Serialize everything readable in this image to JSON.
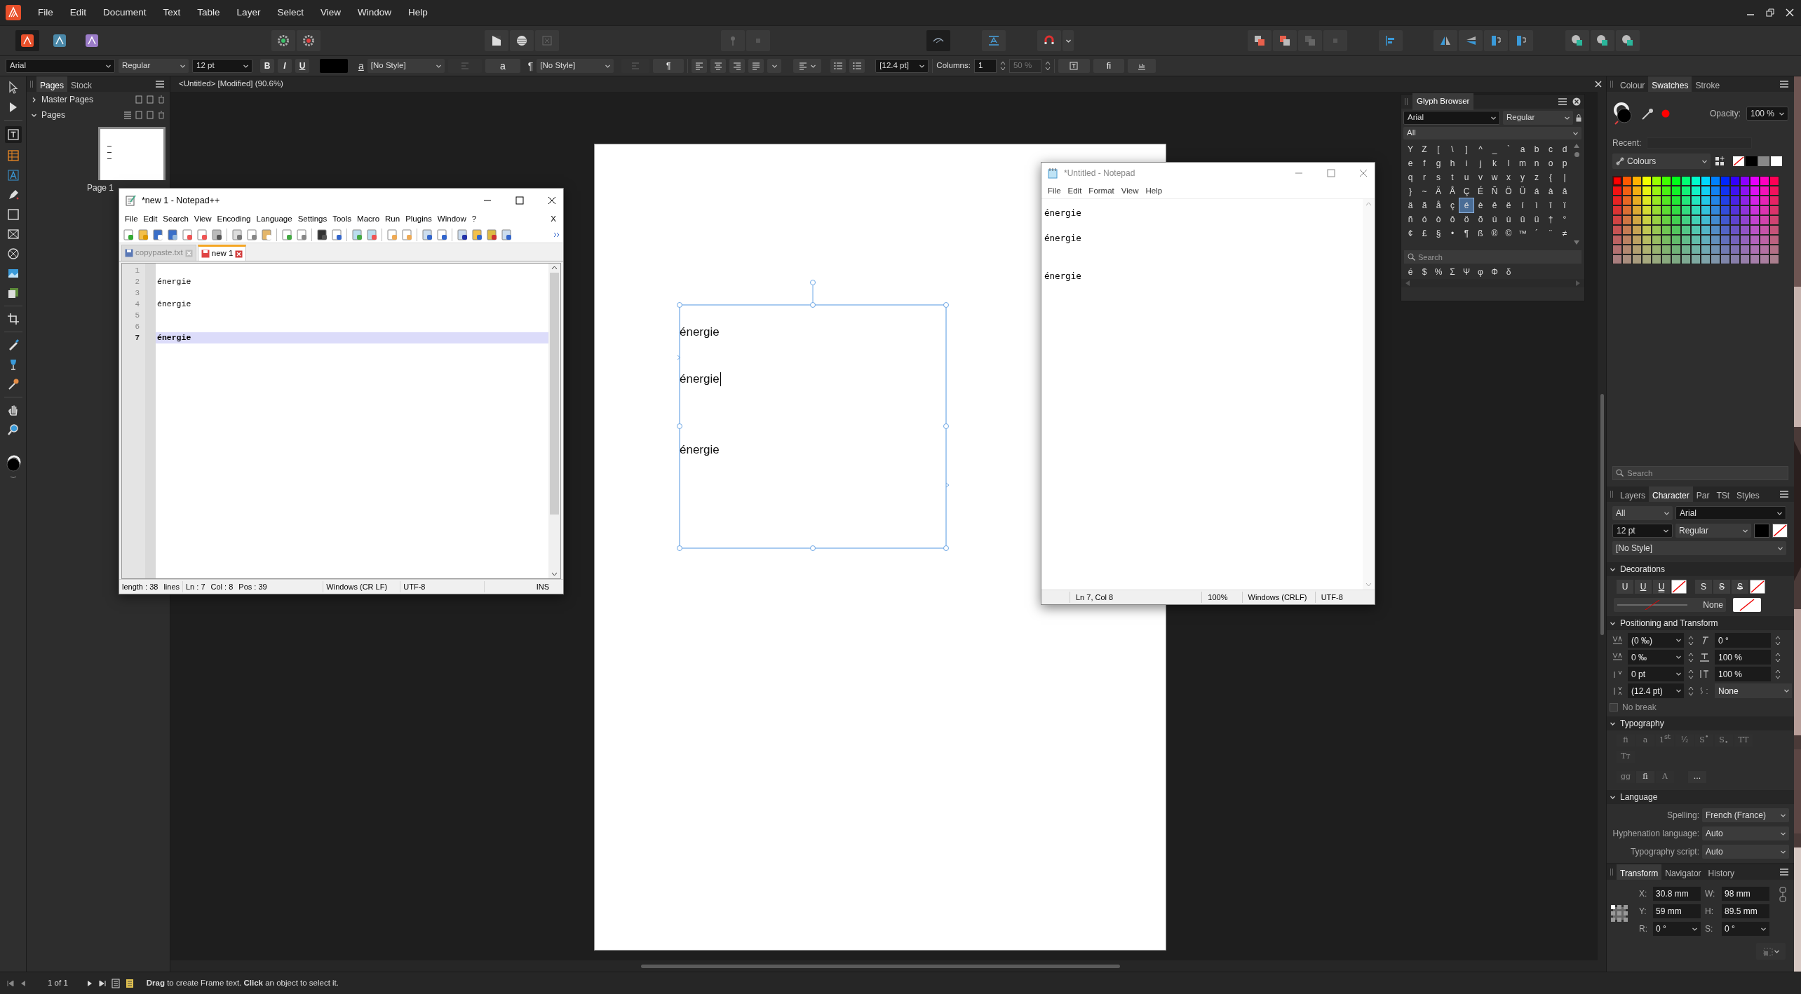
{
  "menu": [
    "File",
    "Edit",
    "Document",
    "Text",
    "Table",
    "Layer",
    "Select",
    "View",
    "Window",
    "Help"
  ],
  "context_bar": {
    "font": "Arial",
    "font_style": "Regular",
    "size": "12 pt",
    "bold": "B",
    "italic": "I",
    "underline": "U",
    "char_style_glyph": "a",
    "char_style": "[No Style]",
    "char_style_button": "a",
    "para_style_glyph": "¶",
    "para_style": "[No Style]",
    "para_style_button": "¶",
    "leading": "[12.4 pt]",
    "columns_label": "Columns:",
    "columns": "1",
    "gutter": "50 %",
    "ligature_button": "fi"
  },
  "document_tab": "<Untitled> [Modified] (90.6%)",
  "pages_panel": {
    "tabs": [
      {
        "label": "Pages",
        "selected": true
      },
      {
        "label": "Stock",
        "selected": false
      }
    ],
    "sections": [
      {
        "label": "Master Pages",
        "expanded": false
      },
      {
        "label": "Pages",
        "expanded": true
      }
    ],
    "page_label": "Page 1"
  },
  "text_frame": {
    "lines": [
      {
        "kind": "text",
        "text": "énergie",
        "caret": false
      },
      {
        "kind": "blank"
      },
      {
        "kind": "text",
        "text": "énergie",
        "caret": true
      },
      {
        "kind": "blank"
      },
      {
        "kind": "blank"
      },
      {
        "kind": "text",
        "text": "énergie",
        "caret": false
      }
    ]
  },
  "notepad_plus": {
    "title": "*new 1 - Notepad++",
    "menu": [
      "File",
      "Edit",
      "Search",
      "View",
      "Encoding",
      "Language",
      "Settings",
      "Tools",
      "Macro",
      "Run",
      "Plugins",
      "Window",
      "?"
    ],
    "close_doc": "X",
    "tabs": [
      {
        "label": "copypaste.txt",
        "selected": false
      },
      {
        "label": "new 1",
        "selected": true
      }
    ],
    "lines": [
      {
        "number": "1",
        "current": false
      },
      {
        "number": "2",
        "text": "énergie",
        "current": false
      },
      {
        "number": "3",
        "current": false
      },
      {
        "number": "4",
        "text": "énergie",
        "current": false
      },
      {
        "number": "5",
        "current": false
      },
      {
        "number": "6",
        "current": false
      },
      {
        "number": "7",
        "text": "énergie",
        "current": true
      }
    ],
    "status": {
      "length": "length : 38",
      "lines": "lines",
      "line": "Ln : 7",
      "column": "Col : 8",
      "position": "Pos : 39",
      "eol": "Windows (CR LF)",
      "encoding": "UTF-8",
      "mode": "INS"
    }
  },
  "notepad": {
    "title": "*Untitled - Notepad",
    "menu": [
      "File",
      "Edit",
      "Format",
      "View",
      "Help"
    ],
    "text": "énergie\n\nénergie\n\n\nénergie",
    "status": [
      "Ln 7, Col 8",
      "100%",
      "Windows (CRLF)",
      "UTF-8"
    ]
  },
  "glyph_browser": {
    "title": "Glyph Browser",
    "font": "Arial",
    "style": "Regular",
    "range": "All",
    "rows": [
      {
        "glyphs": [
          {
            "char": "Y",
            "selected": false
          },
          {
            "char": "Z",
            "selected": false
          },
          {
            "char": "[",
            "selected": false
          },
          {
            "char": "\\",
            "selected": false
          },
          {
            "char": "]",
            "selected": false
          },
          {
            "char": "^",
            "selected": false
          },
          {
            "char": "_",
            "selected": false
          },
          {
            "char": "`",
            "selected": false
          },
          {
            "char": "a",
            "selected": false
          },
          {
            "char": "b",
            "selected": false
          },
          {
            "char": "c",
            "selected": false
          },
          {
            "char": "d",
            "selected": false
          }
        ]
      },
      {
        "glyphs": [
          {
            "char": "e",
            "selected": false
          },
          {
            "char": "f",
            "selected": false
          },
          {
            "char": "g",
            "selected": false
          },
          {
            "char": "h",
            "selected": false
          },
          {
            "char": "i",
            "selected": false
          },
          {
            "char": "j",
            "selected": false
          },
          {
            "char": "k",
            "selected": false
          },
          {
            "char": "l",
            "selected": false
          },
          {
            "char": "m",
            "selected": false
          },
          {
            "char": "n",
            "selected": false
          },
          {
            "char": "o",
            "selected": false
          },
          {
            "char": "p",
            "selected": false
          }
        ]
      },
      {
        "glyphs": [
          {
            "char": "q",
            "selected": false
          },
          {
            "char": "r",
            "selected": false
          },
          {
            "char": "s",
            "selected": false
          },
          {
            "char": "t",
            "selected": false
          },
          {
            "char": "u",
            "selected": false
          },
          {
            "char": "v",
            "selected": false
          },
          {
            "char": "w",
            "selected": false
          },
          {
            "char": "x",
            "selected": false
          },
          {
            "char": "y",
            "selected": false
          },
          {
            "char": "z",
            "selected": false
          },
          {
            "char": "{",
            "selected": false
          },
          {
            "char": "|",
            "selected": false
          }
        ]
      },
      {
        "glyphs": [
          {
            "char": "}",
            "selected": false
          },
          {
            "char": "~",
            "selected": false
          },
          {
            "char": "Ä",
            "selected": false
          },
          {
            "char": "Å",
            "selected": false
          },
          {
            "char": "Ç",
            "selected": false
          },
          {
            "char": "É",
            "selected": false
          },
          {
            "char": "Ñ",
            "selected": false
          },
          {
            "char": "Ö",
            "selected": false
          },
          {
            "char": "Ü",
            "selected": false
          },
          {
            "char": "á",
            "selected": false
          },
          {
            "char": "à",
            "selected": false
          },
          {
            "char": "â",
            "selected": false
          }
        ]
      },
      {
        "glyphs": [
          {
            "char": "ä",
            "selected": false
          },
          {
            "char": "ã",
            "selected": false
          },
          {
            "char": "å",
            "selected": false
          },
          {
            "char": "ç",
            "selected": false
          },
          {
            "char": "é",
            "selected": true
          },
          {
            "char": "è",
            "selected": false
          },
          {
            "char": "ê",
            "selected": false
          },
          {
            "char": "ë",
            "selected": false
          },
          {
            "char": "í",
            "selected": false
          },
          {
            "char": "ì",
            "selected": false
          },
          {
            "char": "î",
            "selected": false
          },
          {
            "char": "ï",
            "selected": false
          }
        ]
      },
      {
        "glyphs": [
          {
            "char": "ñ",
            "selected": false
          },
          {
            "char": "ó",
            "selected": false
          },
          {
            "char": "ò",
            "selected": false
          },
          {
            "char": "ô",
            "selected": false
          },
          {
            "char": "ö",
            "selected": false
          },
          {
            "char": "õ",
            "selected": false
          },
          {
            "char": "ú",
            "selected": false
          },
          {
            "char": "ù",
            "selected": false
          },
          {
            "char": "û",
            "selected": false
          },
          {
            "char": "ü",
            "selected": false
          },
          {
            "char": "†",
            "selected": false
          },
          {
            "char": "°",
            "selected": false
          }
        ]
      },
      {
        "glyphs": [
          {
            "char": "¢",
            "selected": false
          },
          {
            "char": "£",
            "selected": false
          },
          {
            "char": "§",
            "selected": false
          },
          {
            "char": "•",
            "selected": false
          },
          {
            "char": "¶",
            "selected": false
          },
          {
            "char": "ß",
            "selected": false
          },
          {
            "char": "®",
            "selected": false
          },
          {
            "char": "©",
            "selected": false
          },
          {
            "char": "™",
            "selected": false
          },
          {
            "char": "´",
            "selected": false
          },
          {
            "char": "¨",
            "selected": false
          },
          {
            "char": "≠",
            "selected": false
          }
        ]
      }
    ],
    "search_placeholder": "Search",
    "recent": [
      "é",
      "$",
      "%",
      "Σ",
      "Ψ",
      "φ",
      "Φ",
      "δ"
    ]
  },
  "colour_panel": {
    "tabs": [
      {
        "label": "Colour",
        "selected": false
      },
      {
        "label": "Swatches",
        "selected": true
      },
      {
        "label": "Stroke",
        "selected": false
      }
    ],
    "opacity_label": "Opacity:",
    "opacity": "100 %",
    "recent_label": "Recent:",
    "palette": "Colours",
    "search_placeholder": "Search"
  },
  "character_panel": {
    "tabs": [
      {
        "label": "Layers",
        "selected": false
      },
      {
        "label": "Character",
        "selected": true
      },
      {
        "label": "Par",
        "selected": false
      },
      {
        "label": "TSt",
        "selected": false
      },
      {
        "label": "Styles",
        "selected": false
      }
    ],
    "scope": "All",
    "font": "Arial",
    "size": "12 pt",
    "style": "Regular",
    "char_style": "[No Style]",
    "decorations": {
      "title": "Decorations",
      "expanded": true,
      "buttons": [
        {
          "label": "U",
          "kind": "plain"
        },
        {
          "label": "U",
          "kind": "underline"
        },
        {
          "label": "U",
          "kind": "double-underline"
        },
        {
          "label": "S",
          "kind": "plain"
        },
        {
          "label": "S",
          "kind": "strike"
        },
        {
          "label": "S",
          "kind": "double-strike"
        }
      ],
      "line_style": "None"
    },
    "positioning": {
      "title": "Positioning and Transform",
      "expanded": true,
      "fields": [
        {
          "value": "(0 ‰)"
        },
        {
          "value": "0 °"
        },
        {
          "value": "0 ‰"
        },
        {
          "value": "100 %"
        },
        {
          "value": "0 pt"
        },
        {
          "value": "100 %"
        },
        {
          "value": "(12.4 pt)"
        },
        {
          "value": "None"
        }
      ],
      "no_break": {
        "label": "No break",
        "checked": false
      }
    },
    "typography": {
      "title": "Typography",
      "expanded": true,
      "buttons": [
        {
          "label": "fi",
          "disabled": true
        },
        {
          "label": "a",
          "disabled": true
        },
        {
          "label": "1$^{st}$",
          "disabled": true
        },
        {
          "label": "½",
          "disabled": true
        },
        {
          "label": "S$^{•}$",
          "disabled": true
        },
        {
          "label": "S$_{•}$",
          "disabled": true
        },
        {
          "label": "TT",
          "disabled": true
        },
        {
          "label": "Tт",
          "disabled": true
        },
        {
          "label": "gg",
          "disabled": true
        },
        {
          "label": "fi",
          "disabled": false
        },
        {
          "label": "A",
          "disabled": true
        },
        {
          "label": "...",
          "disabled": false
        }
      ]
    },
    "language": {
      "title": "Language",
      "expanded": true,
      "rows": [
        {
          "label": "Spelling:",
          "value": "French (France)"
        },
        {
          "label": "Hyphenation language:",
          "value": "Auto"
        },
        {
          "label": "Typography script:",
          "value": "Auto"
        }
      ]
    }
  },
  "transform_panel": {
    "tabs": [
      {
        "label": "Transform",
        "selected": true
      },
      {
        "label": "Navigator",
        "selected": false
      },
      {
        "label": "History",
        "selected": false
      }
    ],
    "fields": [
      {
        "label": "X:",
        "value": "30.8 mm"
      },
      {
        "label": "W:",
        "value": "98 mm"
      },
      {
        "label": "Y:",
        "value": "59 mm"
      },
      {
        "label": "H:",
        "value": "89.5 mm"
      },
      {
        "label": "R:",
        "value": "0 °"
      },
      {
        "label": "S:",
        "value": "0 °"
      }
    ]
  },
  "status_bar": {
    "page_count": "1 of 1",
    "hint": "**Drag** to create Frame text. **Click** an object to select it."
  }
}
